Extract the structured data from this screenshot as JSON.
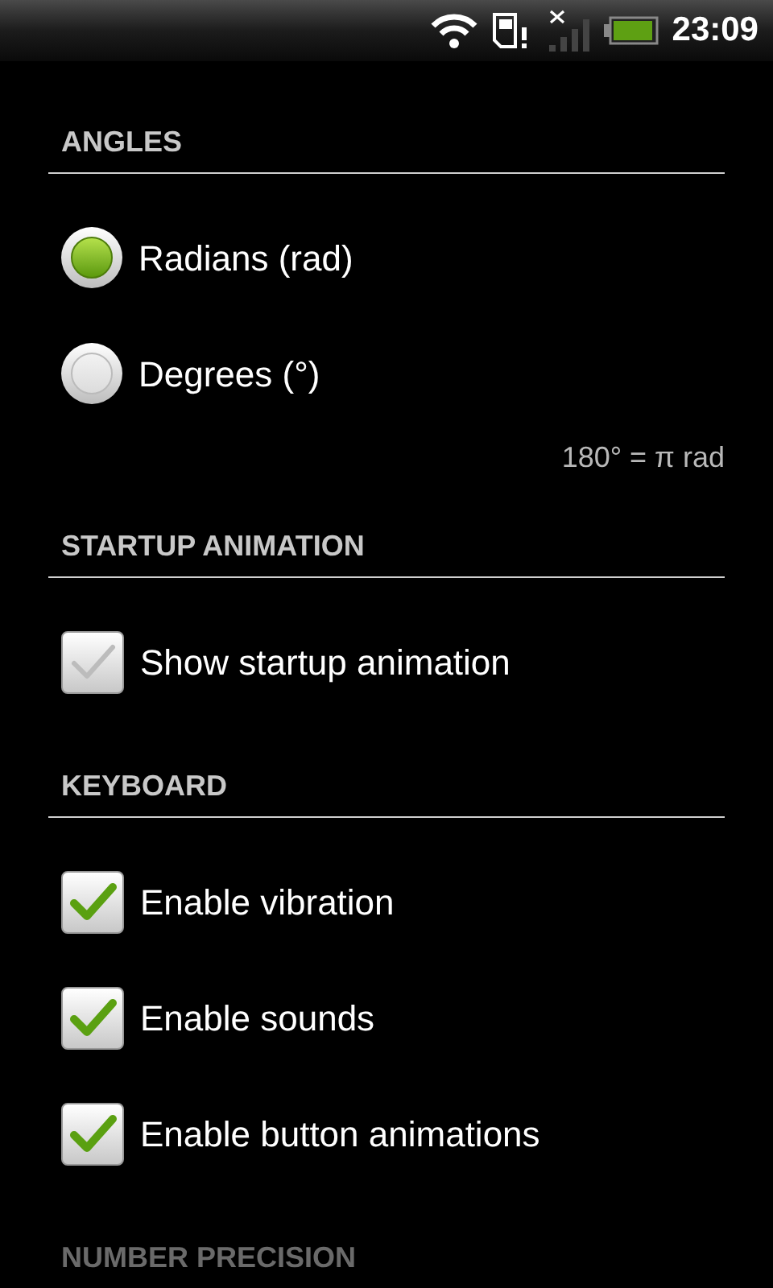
{
  "status_bar": {
    "time": "23:09"
  },
  "sections": [
    {
      "title": "ANGLES",
      "faded": false,
      "items": [
        {
          "kind": "radio",
          "label": "Radians (rad)",
          "selected": true
        },
        {
          "kind": "radio",
          "label": "Degrees (°)",
          "selected": false
        }
      ],
      "hint": "180° = π rad"
    },
    {
      "title": "STARTUP ANIMATION",
      "faded": false,
      "items": [
        {
          "kind": "checkbox",
          "label": "Show startup animation",
          "checked": false
        }
      ]
    },
    {
      "title": "KEYBOARD",
      "faded": false,
      "items": [
        {
          "kind": "checkbox",
          "label": "Enable vibration",
          "checked": true
        },
        {
          "kind": "checkbox",
          "label": "Enable sounds",
          "checked": true
        },
        {
          "kind": "checkbox",
          "label": "Enable button animations",
          "checked": true
        }
      ]
    },
    {
      "title": "NUMBER PRECISION",
      "faded": true
    }
  ]
}
